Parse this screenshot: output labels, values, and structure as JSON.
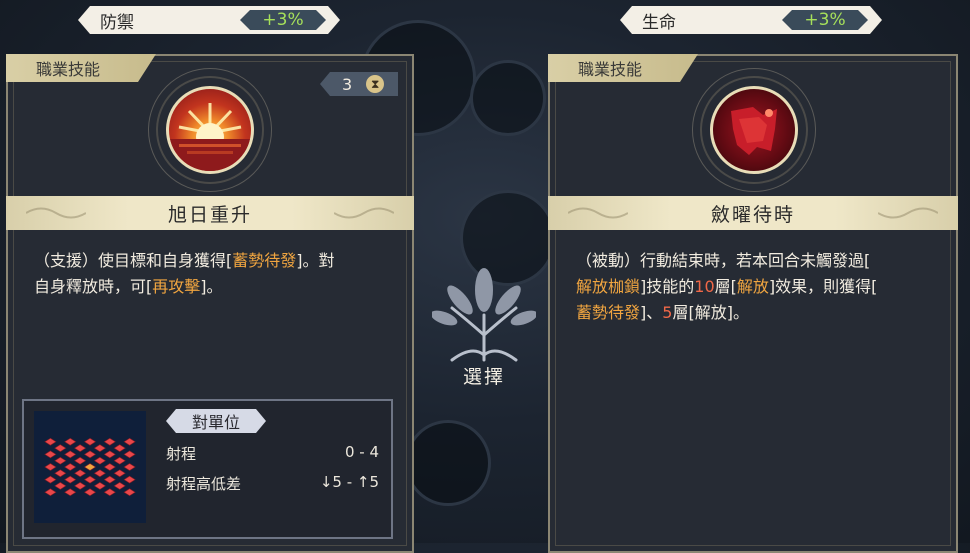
{
  "stats": [
    {
      "label": "防禦",
      "value": "+3%"
    },
    {
      "label": "生命",
      "value": "+3%"
    }
  ],
  "center": {
    "select_label": "選擇"
  },
  "left_card": {
    "tag": "職業技能",
    "cost_count": "3",
    "skill_name": "旭日重升",
    "desc": [
      [
        {
          "t": "（支援）使目標和自身獲得["
        },
        {
          "t": "蓄勢待發",
          "c": "or"
        },
        {
          "t": "]。對"
        }
      ],
      [
        {
          "t": "自身釋放時，可["
        },
        {
          "t": "再攻擊",
          "c": "or"
        },
        {
          "t": "]。"
        }
      ]
    ],
    "range": {
      "header": "對單位",
      "rows": [
        {
          "label": "射程",
          "value": "0 - 4"
        },
        {
          "label": "射程高低差",
          "value": "↓5 - ↑5"
        }
      ]
    }
  },
  "right_card": {
    "tag": "職業技能",
    "skill_name": "斂曜待時",
    "desc": [
      [
        {
          "t": "（被動）行動結束時，若本回合未觸發過["
        }
      ],
      [
        {
          "t": "解放枷鎖",
          "c": "or"
        },
        {
          "t": "]技能的"
        },
        {
          "t": "10",
          "c": "red"
        },
        {
          "t": "層["
        },
        {
          "t": "解放",
          "c": "or"
        },
        {
          "t": "]效果，則獲得["
        }
      ],
      [
        {
          "t": "蓄勢待發",
          "c": "or"
        },
        {
          "t": "]、"
        },
        {
          "t": "5",
          "c": "red"
        },
        {
          "t": "層[解放]。"
        }
      ]
    ]
  },
  "colors": {
    "accent_orange": "#f0a540",
    "accent_red": "#f06848",
    "stat_green": "#a6e05a",
    "title_bar": "#efe7c8"
  },
  "icons": [
    "hourglass-icon",
    "sunrise-skill-icon",
    "crimson-skill-icon",
    "tree-emblem-icon",
    "range-grid-icon"
  ]
}
